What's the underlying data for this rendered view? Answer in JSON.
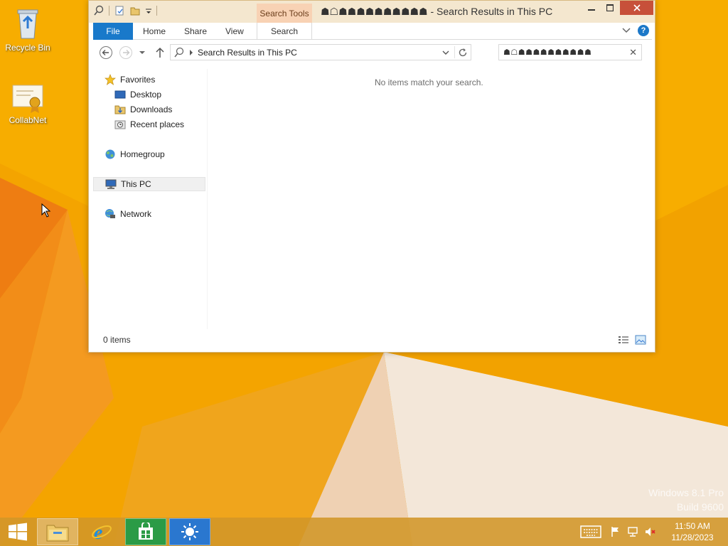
{
  "desktop": {
    "icons": [
      {
        "label": "Recycle Bin"
      },
      {
        "label": "CollabNet"
      }
    ],
    "watermark": {
      "line1": "Windows 8.1 Pro",
      "line2": "Build 9600"
    }
  },
  "window": {
    "title": "☗☖☗☗☗☗☗☗☗☗☗☗ - Search Results in This PC",
    "context_tab": "Search Tools",
    "ribbon_tabs": [
      "File",
      "Home",
      "Share",
      "View",
      "Search"
    ],
    "address": "Search Results in This PC",
    "search_query": "☗☖☗☗☗☗☗☗☗☗☗☗",
    "nav": {
      "favorites": "Favorites",
      "desktop": "Desktop",
      "downloads": "Downloads",
      "recent": "Recent places",
      "homegroup": "Homegroup",
      "this_pc": "This PC",
      "network": "Network"
    },
    "empty_message": "No items match your search.",
    "status": "0 items"
  },
  "taskbar": {
    "time": "11:50 AM",
    "date": "11/28/2023"
  },
  "colors": {
    "accent": "#1979ca",
    "context_tab": "#f8d2b4",
    "close": "#c7503a"
  }
}
